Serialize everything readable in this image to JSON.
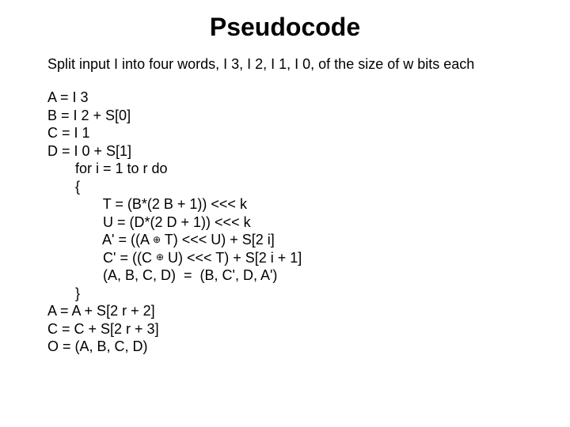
{
  "title": "Pseudocode",
  "intro": "Split input I into four words, I 3, I 2, I 1, I 0, of the size of w bits each",
  "lines": {
    "a": "A = I 3",
    "b": "B = I 2 + S[0]",
    "c": "C = I 1",
    "d": "D = I 0 + S[1]",
    "for": "       for i = 1 to r do",
    "open": "       {",
    "t": "              T = (B*(2 B + 1)) <<< k",
    "u": "              U = (D*(2 D + 1)) <<< k",
    "ap_pre": "              A' = ((A ",
    "ap_post": " T) <<< U) + S[2 i]",
    "cp_pre": "              C' = ((C ",
    "cp_post": " U) <<< T) + S[2 i + 1]",
    "swap": "              (A, B, C, D)  =  (B, C', D, A')",
    "close": "       }",
    "a2": "A = A + S[2 r + 2]",
    "c2": "C = C + S[2 r + 3]",
    "o": "O = (A, B, C, D)"
  },
  "sym": {
    "xor": "⊕"
  }
}
